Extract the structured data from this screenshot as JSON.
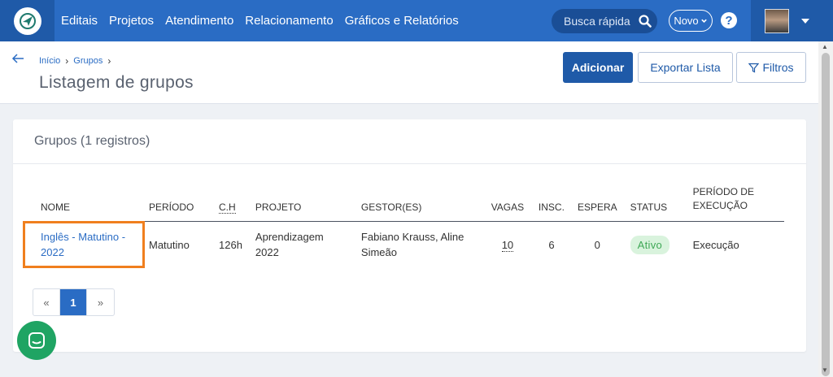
{
  "nav": {
    "items": [
      "Editais",
      "Projetos",
      "Atendimento",
      "Relacionamento",
      "Gráficos e Relatórios"
    ],
    "search_placeholder": "Busca rápida",
    "new_label": "Novo",
    "help_label": "?"
  },
  "breadcrumb": {
    "items": [
      "Início",
      "Grupos"
    ],
    "separator": "›"
  },
  "page": {
    "title": "Listagem de grupos",
    "buttons": {
      "add": "Adicionar",
      "export": "Exportar Lista",
      "filter": "Filtros"
    }
  },
  "card": {
    "title": "Grupos (1 registros)",
    "columns": [
      "NOME",
      "PERÍODO",
      "C.H",
      "PROJETO",
      "GESTOR(ES)",
      "VAGAS",
      "INSC.",
      "ESPERA",
      "STATUS",
      "PERÍODO DE EXECUÇÃO"
    ],
    "rows": [
      {
        "nome": "Inglês - Matutino - 2022",
        "periodo": "Matutino",
        "ch": "126h",
        "projeto": "Aprendizagem 2022",
        "gestor": "Fabiano Krauss, Aline Simeão",
        "vagas": "10",
        "insc": "6",
        "espera": "0",
        "status": "Ativo",
        "execucao": "Execução"
      }
    ]
  },
  "pagination": {
    "prev": "«",
    "current": "1",
    "next": "»"
  },
  "colors": {
    "nav_blue": "#2a6cc4",
    "dark_blue": "#1f5aa8",
    "status_green": "#3fa856",
    "highlight_orange": "#f07f1e",
    "chat_green": "#1fa463"
  }
}
